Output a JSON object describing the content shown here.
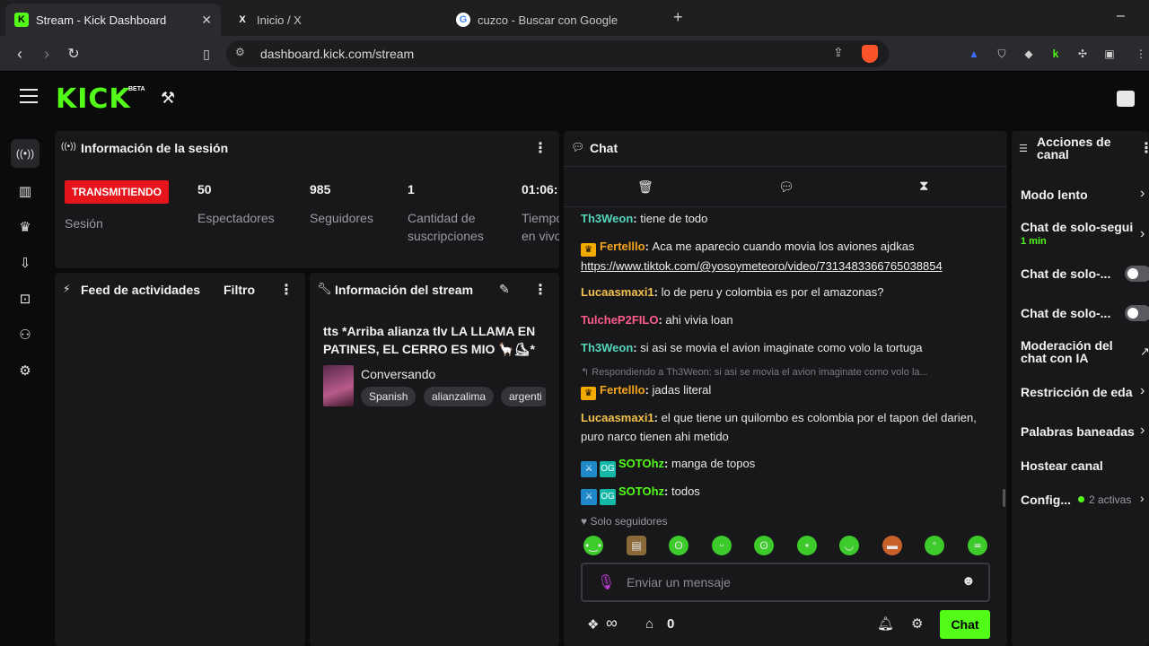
{
  "browser": {
    "tabs": [
      {
        "title": "Stream - Kick Dashboard",
        "favicon": "K"
      },
      {
        "title": "Inicio / X",
        "favicon": "X"
      },
      {
        "title": "cuzco - Buscar con Google",
        "favicon": "G"
      }
    ],
    "new_tab": "+",
    "url": "dashboard.kick.com/stream",
    "window_minimize": "–"
  },
  "app": {
    "logo": "KICK",
    "logo_badge": "BETA"
  },
  "session": {
    "title": "Información de la sesión",
    "status": "TRANSMITIENDO",
    "status_label": "Sesión",
    "stats": [
      {
        "value": "50",
        "label": "Espectadores"
      },
      {
        "value": "985",
        "label": "Seguidores"
      },
      {
        "value": "1",
        "label": "Cantidad de suscripciones"
      },
      {
        "value": "01:06:",
        "label": "Tiempo en vivo"
      }
    ]
  },
  "activity": {
    "title": "Feed de actividades",
    "filter_label": "Filtro"
  },
  "stream_info": {
    "title": "Información del stream",
    "stream_title": "tts *Arriba alianza tlv LA LLAMA EN PATINES, EL CERRO ES MIO 🦙⛸*",
    "category": "Conversando",
    "tags": [
      "Spanish",
      "alianzalima",
      "argenti"
    ]
  },
  "chat": {
    "title": "Chat",
    "messages": [
      {
        "user": "Th3Weon",
        "color": "#53d6b8",
        "text": "tiene de todo",
        "badges": []
      },
      {
        "user": "Fertelllo",
        "color": "#f2a51b",
        "text": "Aca me aparecio cuando movia los aviones ajdkas",
        "link": "https://www.tiktok.com/@yosoymeteoro/video/7313483366765038854",
        "badges": [
          "crown"
        ]
      },
      {
        "user": "Lucaasmaxi1",
        "color": "#f2c14e",
        "text": "lo de peru y colombia es por el amazonas?",
        "badges": []
      },
      {
        "user": "TulcheP2FILO",
        "color": "#ff5c8a",
        "text": "ahi vivia loan",
        "badges": []
      },
      {
        "user": "Th3Weon",
        "color": "#53d6b8",
        "text": "si asi se movia el avion imaginate como volo la tortuga",
        "badges": []
      },
      {
        "reply": "Respondiendo a Th3Weon: si asi se movia el avion imaginate como volo la..."
      },
      {
        "user": "Fertelllo",
        "color": "#f2a51b",
        "text": "jadas literal",
        "badges": [
          "crown"
        ]
      },
      {
        "user": "Lucaasmaxi1",
        "color": "#f2c14e",
        "text": "el que tiene un quilombo es colombia por el tapon del darien, puro narco tienen ahi metido",
        "badges": []
      },
      {
        "user": "SOTOhz",
        "color": "#53fc18",
        "text": "manga de topos",
        "badges": [
          "mod",
          "og"
        ]
      },
      {
        "user": "SOTOhz",
        "color": "#53fc18",
        "text": "todos",
        "badges": [
          "mod",
          "og"
        ]
      }
    ],
    "mode_label": "Solo seguidores",
    "input_placeholder": "Enviar un mensaje",
    "infinity": "∞",
    "gift_count": "0",
    "send_label": "Chat",
    "accent": "#53fc18"
  },
  "actions": {
    "title": "Acciones de canal",
    "items": [
      {
        "label": "Modo lento"
      },
      {
        "label": "Chat de solo-segui",
        "sub": "1 min"
      },
      {
        "label": "Chat de solo-..."
      },
      {
        "label": "Chat de solo-..."
      },
      {
        "label": "Moderación del chat con IA"
      },
      {
        "label": "Restricción de eda"
      },
      {
        "label": "Palabras baneadas"
      },
      {
        "label": "Hostear canal"
      },
      {
        "label": "Config...",
        "sub": "2 activas"
      }
    ]
  }
}
